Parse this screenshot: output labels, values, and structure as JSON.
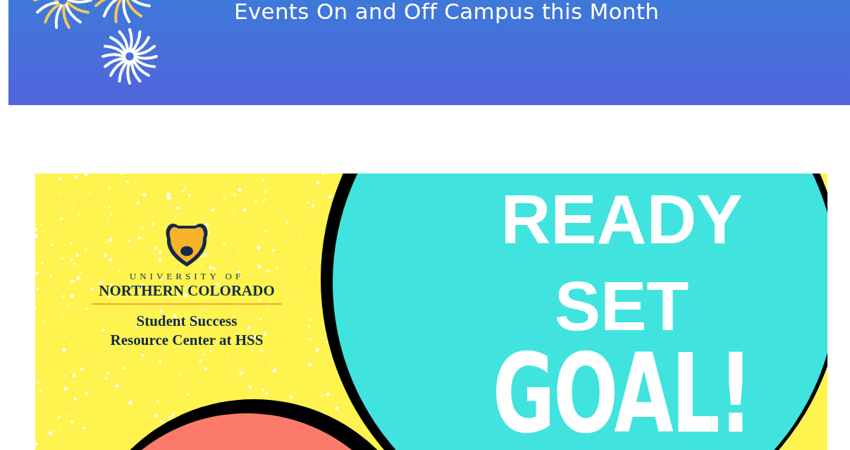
{
  "banner": {
    "heading": "Events On and Off Campus this Month"
  },
  "flyer": {
    "logo": {
      "line_1": "UNIVERSITY OF",
      "line_2": "NORTHERN COLORADO"
    },
    "center_lines": [
      "Student Success",
      "Resource Center at HSS"
    ],
    "headline": [
      "READY",
      "SET",
      "GOAL!"
    ]
  }
}
